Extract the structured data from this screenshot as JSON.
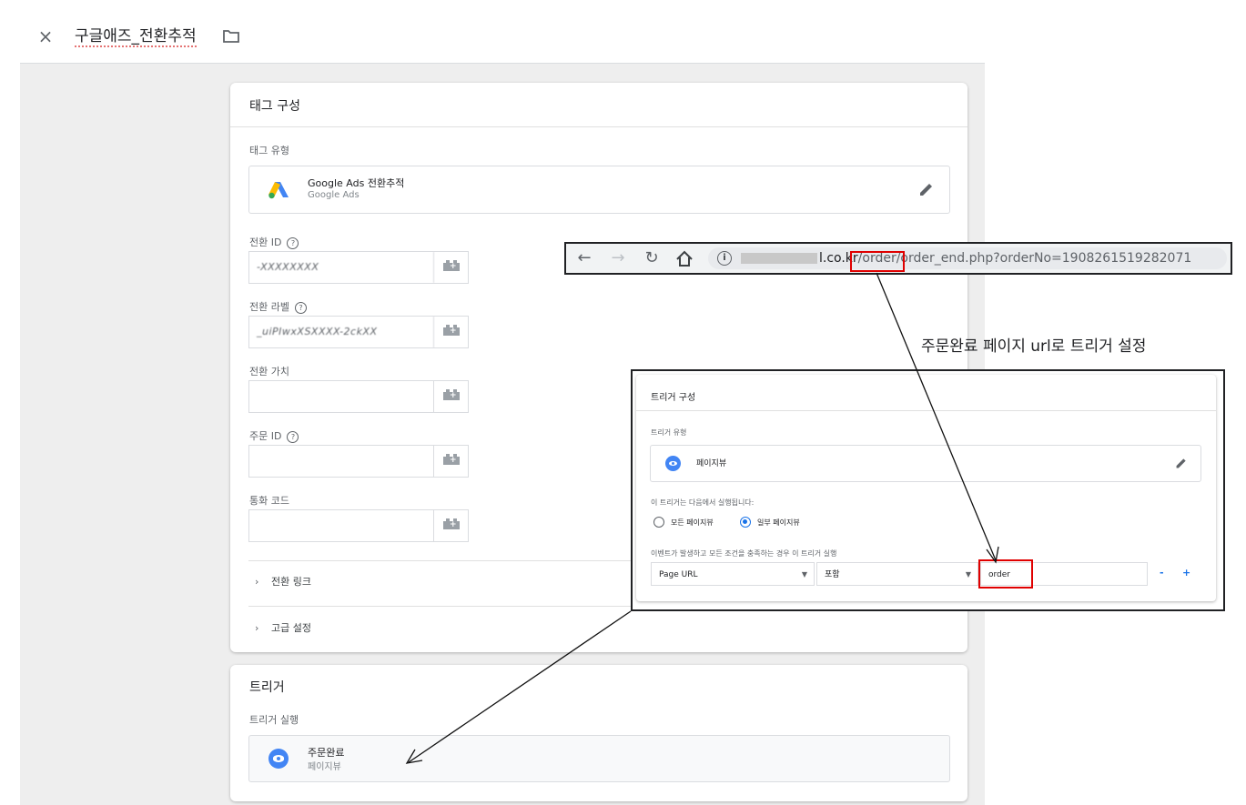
{
  "header": {
    "close_icon": "×",
    "title": "구글애즈_전환추적"
  },
  "tag_config": {
    "card_title": "태그 구성",
    "tag_type_label": "태그 유형",
    "tag_type_name": "Google Ads 전환추적",
    "tag_type_sub": "Google Ads",
    "fields": [
      {
        "label": "전환 ID",
        "help": true,
        "value": "-XXXXXXXX"
      },
      {
        "label": "전환 라벨",
        "help": true,
        "value": "_uiPIwxXSXXXX-2ckXX"
      },
      {
        "label": "전환 가치",
        "help": false,
        "value": ""
      },
      {
        "label": "주문 ID",
        "help": true,
        "value": ""
      },
      {
        "label": "통화 코드",
        "help": false,
        "value": ""
      }
    ],
    "expanders": [
      "전환 링크",
      "고급 설정"
    ]
  },
  "trigger_section": {
    "card_title": "트리거",
    "firing_label": "트리거 실행",
    "trigger_name": "주문완료",
    "trigger_sub": "페이지뷰"
  },
  "url_bar": {
    "host_suffix": "l.co.kr",
    "path": "/order/order_end.php?orderNo=1908261519282071"
  },
  "annotation": "주문완료 페이지 url로 트리거 설정",
  "trigger_config": {
    "card_title": "트리거 구성",
    "type_label": "트리거 유형",
    "type_name": "페이지뷰",
    "fires_on_label": "이 트리거는 다음에서 실행됩니다:",
    "radio_all": "모든 페이지뷰",
    "radio_some": "일부 페이지뷰",
    "selected_radio": "일부 페이지뷰",
    "condition_label": "이벤트가 발생하고 모든 조건을 충족하는 경우 이 트리거 실행",
    "condition": {
      "variable": "Page URL",
      "operator": "포함",
      "value": "order"
    },
    "minus": "-",
    "plus": "+"
  },
  "colors": {
    "highlight": "#e00000",
    "accent": "#1a73e8",
    "editor_bg": "#eeeeee"
  }
}
